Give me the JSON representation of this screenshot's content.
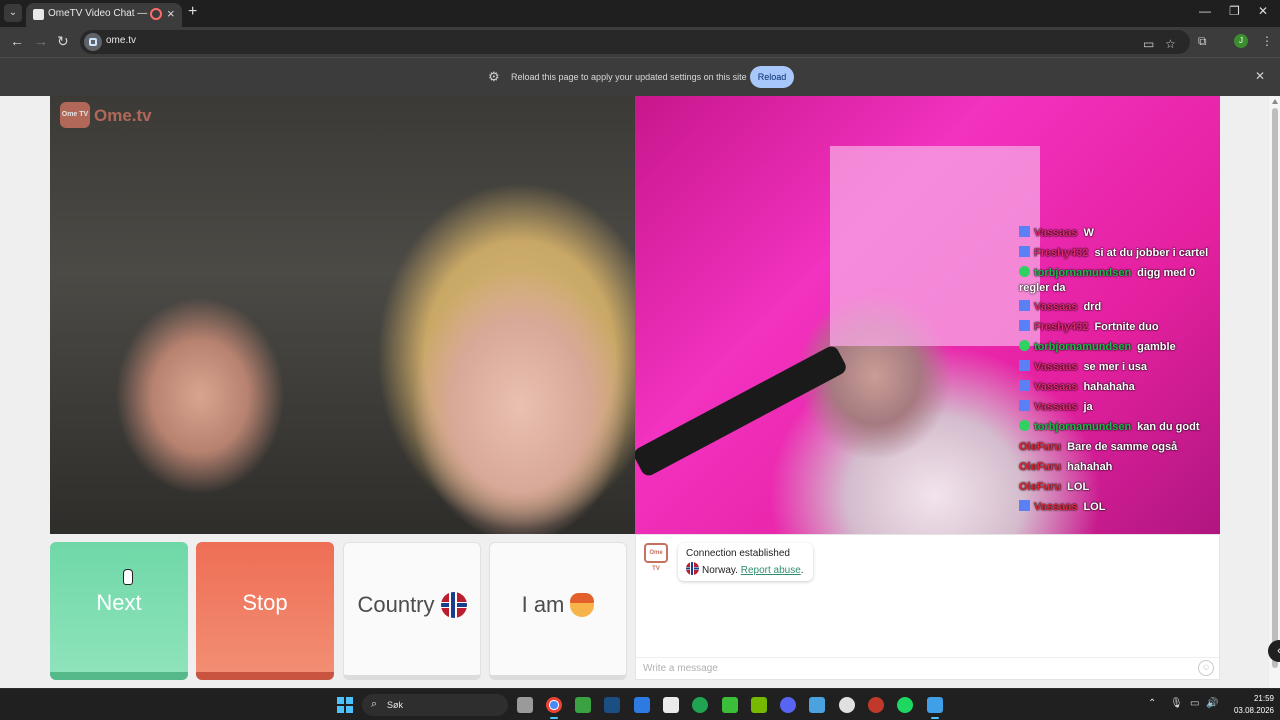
{
  "browser": {
    "tab_title": "OmeTV Video Chat — Ome",
    "url": "ome.tv",
    "icons": {
      "tab_menu": "chevron-down-icon",
      "new_tab": "plus-icon",
      "back": "arrow-left-icon",
      "forward": "arrow-right-icon",
      "reload": "reload-icon",
      "cast": "cast-icon",
      "bookmark": "star-icon",
      "extensions": "puzzle-icon",
      "menu": "kebab-menu-icon"
    },
    "profile_initial": "J",
    "window_controls": [
      "minimize",
      "restore",
      "close"
    ]
  },
  "infobar": {
    "message": "Reload this page to apply your updated settings on this site",
    "reload_label": "Reload"
  },
  "app": {
    "logo_mark": "Ome TV",
    "logo_text": "Ome.tv",
    "brand_color": "#c6705f"
  },
  "overlay_chat": [
    {
      "platform": "twitch",
      "user": "Vassaas",
      "text": "W"
    },
    {
      "platform": "twitch",
      "user": "Freshy432",
      "text": "si at du jobber i cartel"
    },
    {
      "platform": "kick",
      "user": "torbjornamundsen",
      "text": "digg med 0 regler da"
    },
    {
      "platform": "twitch",
      "user": "Vassaas",
      "text": "drd"
    },
    {
      "platform": "twitch",
      "user": "Freshy432",
      "text": "Fortnite duo"
    },
    {
      "platform": "kick",
      "user": "torbjornamundsen",
      "text": "gamble"
    },
    {
      "platform": "twitch",
      "user": "Vassaas",
      "text": "se mer i usa"
    },
    {
      "platform": "twitch",
      "user": "Vassaas",
      "text": "hahahaha"
    },
    {
      "platform": "twitch",
      "user": "Vassaas",
      "text": "ja"
    },
    {
      "platform": "kick",
      "user": "torbjornamundsen",
      "text": "kan du godt"
    },
    {
      "platform": "none",
      "user": "OleFuru",
      "text": "Bare de samme også"
    },
    {
      "platform": "none",
      "user": "OleFuru",
      "text": "hahahah"
    },
    {
      "platform": "none",
      "user": "OleFuru",
      "text": "LOL"
    },
    {
      "platform": "twitch",
      "user": "Vassaas",
      "text": "LOL"
    }
  ],
  "controls": {
    "next_label": "Next",
    "stop_label": "Stop",
    "country_label": "Country",
    "iam_label": "I am",
    "colors": {
      "next": "#6fd8a8",
      "stop": "#ee6e55"
    }
  },
  "chat": {
    "status_line": "Connection established",
    "country": "Norway.",
    "report_link": "Report abuse",
    "report_suffix": ".",
    "input_placeholder": "Write a message"
  },
  "taskbar": {
    "search_placeholder": "Søk",
    "time": "21:59",
    "date": "03.08.2026",
    "apps": [
      "task-view",
      "chrome",
      "minecraft",
      "steam",
      "visual-studio",
      "capcut",
      "gamepass",
      "xbox",
      "nvidia",
      "discord",
      "photos",
      "obs",
      "opera-gx",
      "spotify",
      "app"
    ]
  }
}
